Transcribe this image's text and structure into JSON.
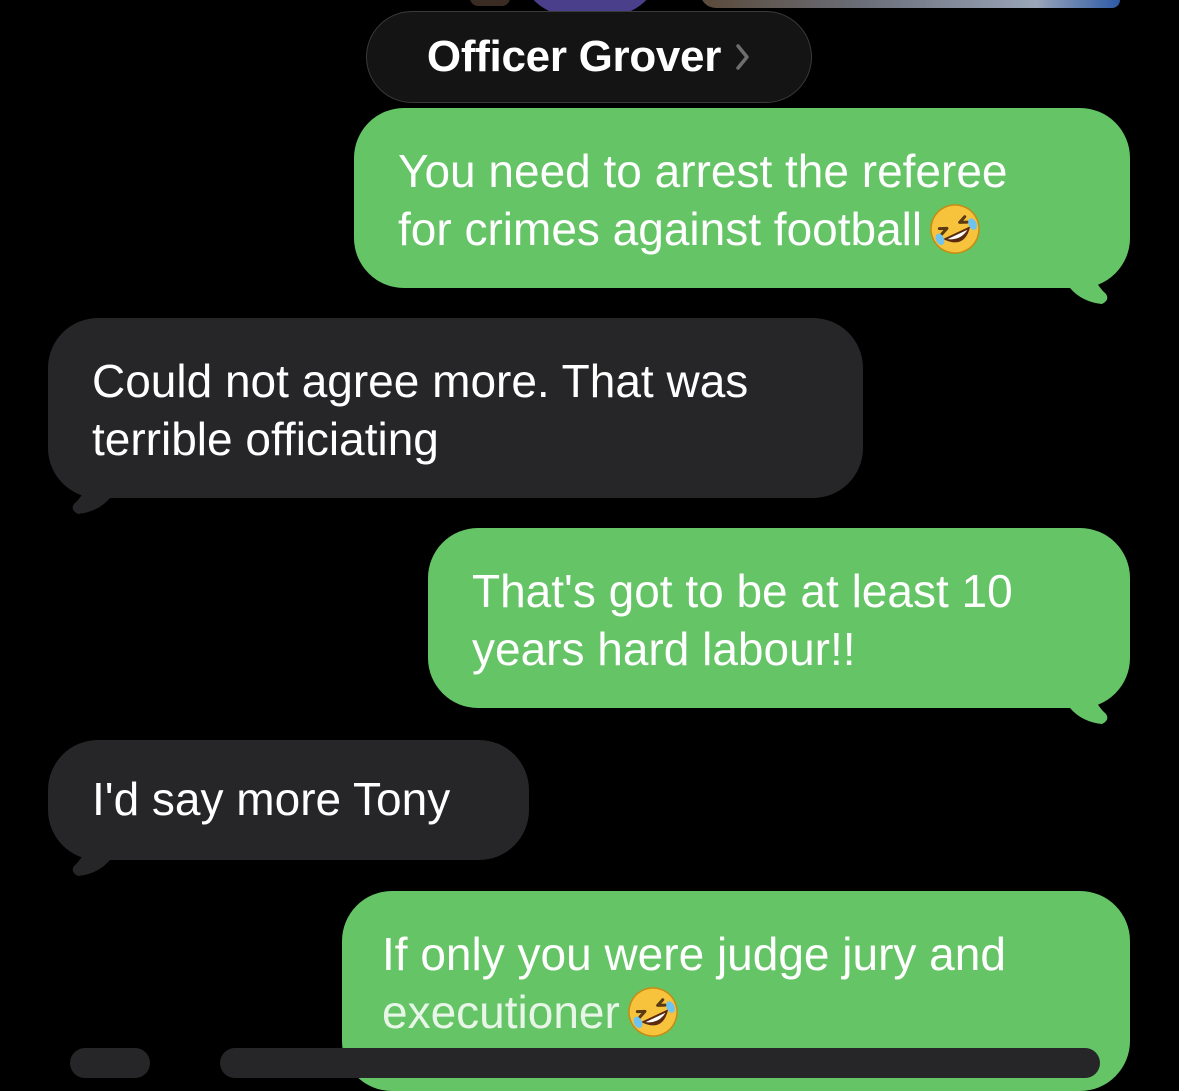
{
  "header": {
    "contact_name": "Officer Grover",
    "chevron_icon": "chevron-right-icon"
  },
  "colors": {
    "sent_bubble": "#65c466",
    "received_bubble": "#262628",
    "background": "#000000"
  },
  "messages": [
    {
      "direction": "sent",
      "lines": [
        "You need to arrest the referee",
        "for crimes against football"
      ],
      "trailing_emoji": "rolling-on-floor-laughing-emoji"
    },
    {
      "direction": "received",
      "lines": [
        "Could not agree more. That was",
        "terrible officiating"
      ]
    },
    {
      "direction": "sent",
      "lines": [
        "That's got to be at least 10",
        "years hard labour!!"
      ]
    },
    {
      "direction": "received",
      "lines": [
        "I'd say more Tony"
      ]
    },
    {
      "direction": "sent",
      "lines": [
        "If only you were judge jury and",
        "executioner"
      ],
      "trailing_emoji": "rolling-on-floor-laughing-emoji"
    }
  ]
}
